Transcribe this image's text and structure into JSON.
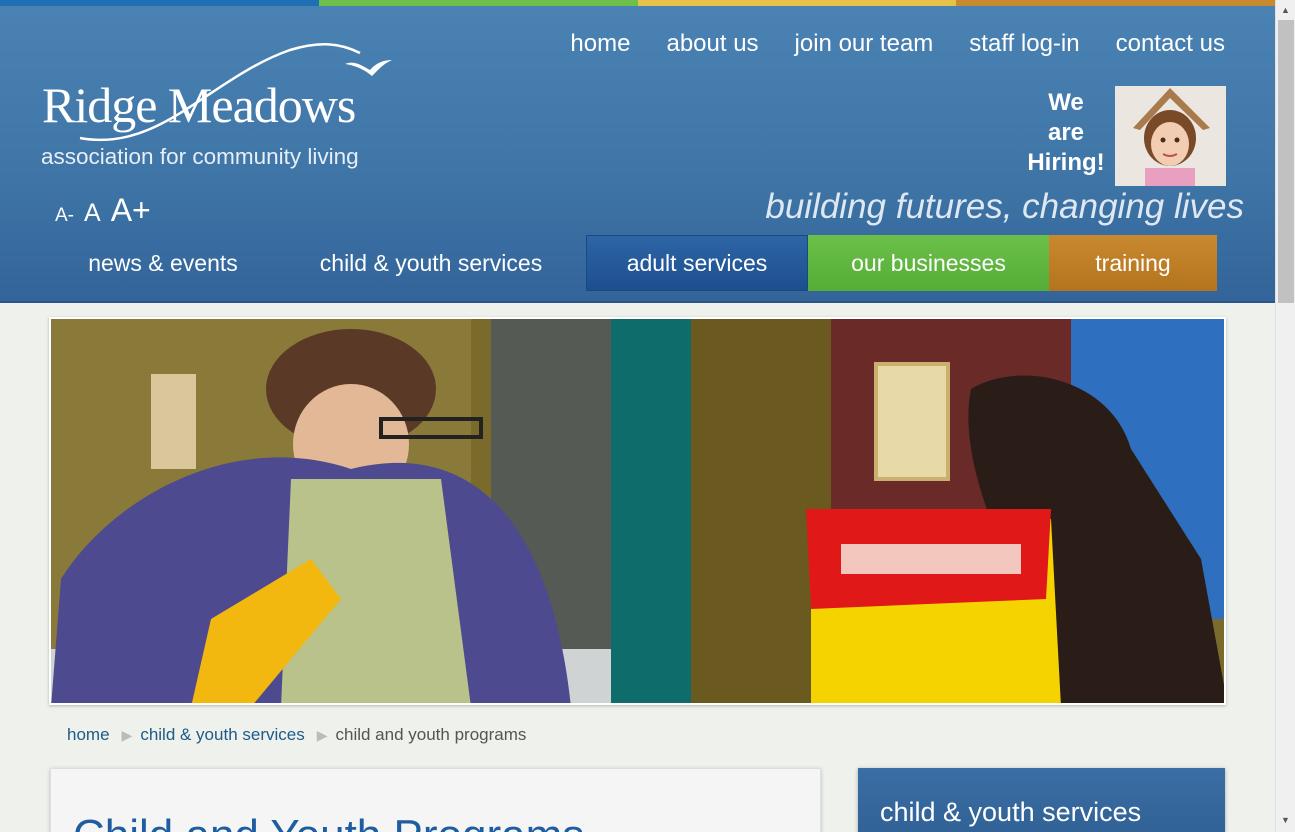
{
  "colors": {
    "strip": [
      "#1f6fb4",
      "#6cbf48",
      "#e6c24a",
      "#c9892f"
    ],
    "header": "#3f76a7",
    "link": "#1f5a8a",
    "title": "#1e5da0"
  },
  "logo": {
    "name": "Ridge Meadows",
    "tagline": "association for community living"
  },
  "top_nav": [
    "home",
    "about us",
    "join our team",
    "staff log-in",
    "contact us"
  ],
  "hiring": {
    "line1": "We",
    "line2": "are",
    "line3": "Hiring!"
  },
  "font_sizer": {
    "small": "A-",
    "normal": "A",
    "large": "A+"
  },
  "slogan": "building futures, changing lives",
  "main_nav": [
    "news & events",
    "child & youth services",
    "adult services",
    "our businesses",
    "training"
  ],
  "breadcrumb": {
    "home": "home",
    "section": "child & youth services",
    "current": "child and youth programs"
  },
  "content": {
    "title": "Child and Youth Programs"
  },
  "sidebar": {
    "title": "child & youth services"
  }
}
